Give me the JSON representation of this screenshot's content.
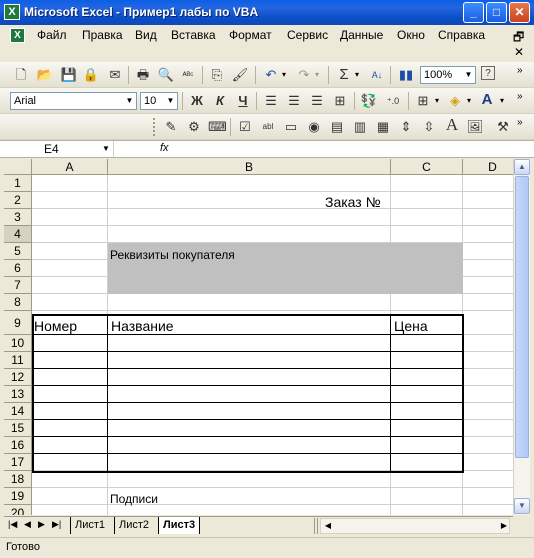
{
  "window": {
    "title": "Microsoft Excel - Пример1 лабы по VBA",
    "min_glyph": "_",
    "max_glyph": "□",
    "close_glyph": "✕"
  },
  "menu": {
    "items": [
      "Файл",
      "Правка",
      "Вид",
      "Вставка",
      "Формат",
      "Сервис",
      "Данные",
      "Окно",
      "Справка"
    ],
    "doc_close_glyph": "✕",
    "doc_restore_glyph": "🗗"
  },
  "toolbar": {
    "zoom": "100%",
    "font_name": "Arial",
    "font_size": "10",
    "bold_label": "Ж",
    "italic_label": "К",
    "underline_label": "Ч",
    "sum_label": "Σ",
    "big_a_label": "A"
  },
  "formula": {
    "cell_ref": "E4",
    "fx_label": "fx",
    "content": ""
  },
  "grid": {
    "columns": [
      "A",
      "B",
      "C",
      "D"
    ],
    "rows": [
      "1",
      "2",
      "3",
      "4",
      "5",
      "6",
      "7",
      "8",
      "9",
      "10",
      "11",
      "12",
      "13",
      "14",
      "15",
      "16",
      "17",
      "18",
      "19",
      "20"
    ],
    "cells": {
      "order_label": "Заказ №",
      "buyer_details": "Реквизиты покупателя",
      "hdr_number": "Номер",
      "hdr_name": "Название",
      "hdr_price": "Цена",
      "signatures": "Подписи"
    },
    "shaded_color": "#C0C0C0"
  },
  "sheets": {
    "tabs": [
      "Лист1",
      "Лист2",
      "Лист3"
    ],
    "active": "Лист3"
  },
  "status": {
    "text": "Готово"
  }
}
